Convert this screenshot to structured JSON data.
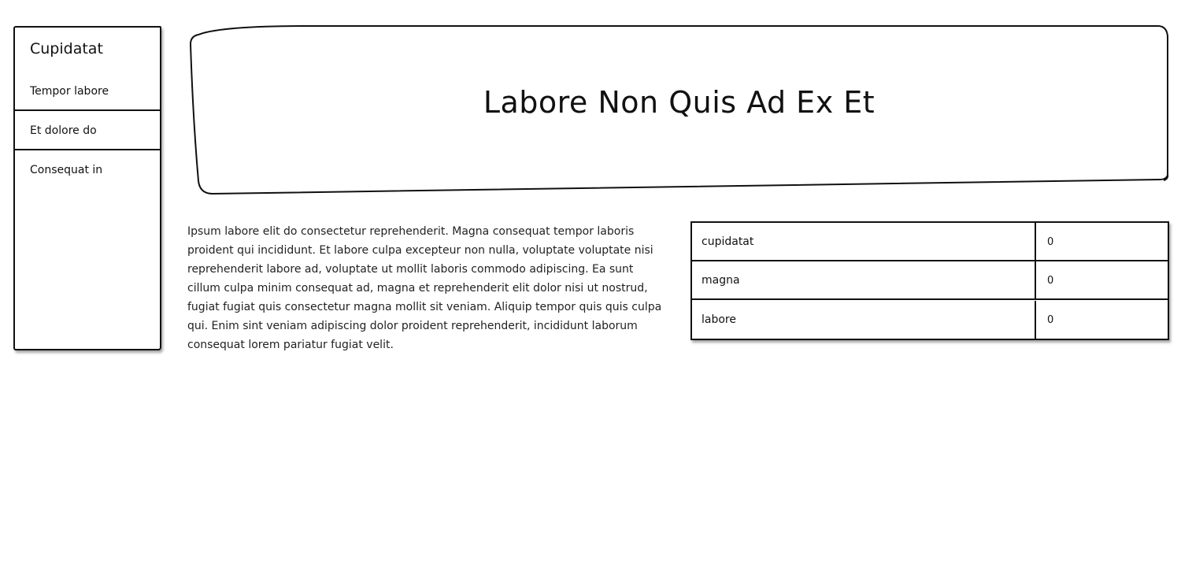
{
  "sidebar": {
    "title": "Cupidatat",
    "items": [
      {
        "label": "Tempor labore"
      },
      {
        "label": "Et dolore do"
      },
      {
        "label": "Consequat in"
      }
    ]
  },
  "hero": {
    "title": "Labore Non Quis Ad Ex Et"
  },
  "content": {
    "paragraph": "Ipsum labore elit do consectetur reprehenderit. Magna consequat tempor laboris proident qui incididunt. Et labore culpa excepteur non nulla, voluptate voluptate nisi reprehenderit labore ad, voluptate ut mollit laboris commodo adipiscing. Ea sunt cillum culpa minim consequat ad, magna et reprehenderit elit dolor nisi ut nostrud, fugiat fugiat quis consectetur magna mollit sit veniam. Aliquip tempor quis quis culpa qui. Enim sint veniam adipiscing dolor proident reprehenderit, incididunt laborum consequat lorem pariatur fugiat velit."
  },
  "table": {
    "rows": [
      {
        "key": "cupidatat",
        "value": "0"
      },
      {
        "key": "magna",
        "value": "0"
      },
      {
        "key": "labore",
        "value": "0"
      }
    ]
  }
}
